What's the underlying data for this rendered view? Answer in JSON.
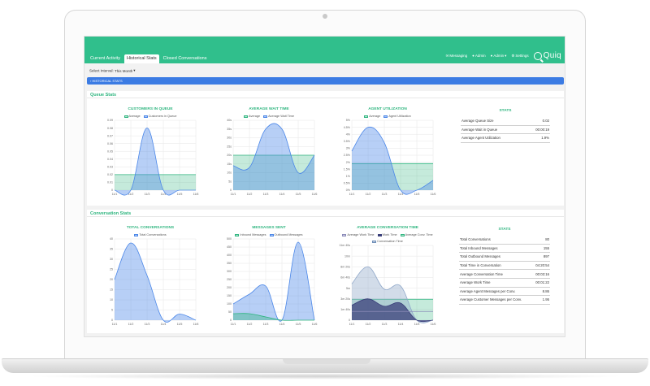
{
  "tabs": [
    {
      "label": "Current Activity",
      "active": false
    },
    {
      "label": "Historical Stats",
      "active": true
    },
    {
      "label": "Closed Conversations",
      "active": false
    }
  ],
  "nav": {
    "messaging": "Messaging",
    "admin": "Admin",
    "account": "Admin",
    "settings": "Settings",
    "logo": "Quiq"
  },
  "interval": {
    "label": "Select Interval:",
    "value": "This Month"
  },
  "historical_bar": "HISTORICAL STATS",
  "queue_section": {
    "title": "Queue Stats",
    "stats_title": "STATS",
    "stats": [
      {
        "label": "Average Queue Size",
        "value": "0.02"
      },
      {
        "label": "Average Wait in Queue",
        "value": "00:00:19"
      },
      {
        "label": "Average Agent Utilization",
        "value": "1.9%"
      }
    ]
  },
  "conversation_section": {
    "title": "Conversation Stats",
    "stats_title": "STATS",
    "stats": [
      {
        "label": "Total Conversations",
        "value": "80"
      },
      {
        "label": "Total Inbound Messages",
        "value": "155"
      },
      {
        "label": "Total Outbound Messages",
        "value": "897"
      },
      {
        "label": "Total Time in Conversation",
        "value": "04:20:54"
      },
      {
        "label": "Average Conversation Time",
        "value": "00:03:16"
      },
      {
        "label": "Average Work Time",
        "value": "00:01:22"
      },
      {
        "label": "Average Agent Messages per Conv.",
        "value": "8.86"
      },
      {
        "label": "Average Customer Messages per Conv.",
        "value": "1.95"
      }
    ]
  },
  "colors": {
    "brand": "#30bf8c",
    "accent_blue": "#3b7be3",
    "series_blue": "#4a86e8",
    "series_green": "#2fb57f"
  },
  "chart_data": [
    {
      "id": "customers-in-queue",
      "type": "area",
      "title": "CUSTOMERS IN QUEUE",
      "legend": [
        "Average",
        "Customers in Queue"
      ],
      "x": [
        "11/1",
        "11/2",
        "11/3",
        "11/4",
        "11/5",
        "11/6"
      ],
      "yticks": [
        "0",
        "0.01",
        "0.02",
        "0.03",
        "0.04",
        "0.05",
        "0.06",
        "0.07",
        "0.08",
        "0.09"
      ],
      "ylim": [
        0,
        0.09
      ],
      "series": [
        {
          "name": "Customers in Queue",
          "values": [
            0,
            0,
            0.08,
            0,
            0,
            0
          ],
          "color": "#4a86e8"
        }
      ],
      "average": 0.02
    },
    {
      "id": "average-wait-time",
      "type": "area",
      "title": "AVERAGE WAIT TIME",
      "legend": [
        "Average",
        "Average Wait Time"
      ],
      "x": [
        "11/1",
        "11/2",
        "11/3",
        "11/4",
        "11/5",
        "11/6"
      ],
      "yticks": [
        "0",
        "5s",
        "10s",
        "15s",
        "20s",
        "25s",
        "30s",
        "35s",
        "40s"
      ],
      "ylim": [
        0,
        40
      ],
      "series": [
        {
          "name": "Average Wait Time",
          "values": [
            14,
            13,
            35,
            35,
            10,
            20
          ],
          "color": "#4a86e8"
        }
      ],
      "average": 20
    },
    {
      "id": "agent-utilization",
      "type": "area",
      "title": "AGENT UTILIZATION",
      "legend": [
        "Average",
        "Agent Utilization"
      ],
      "x": [
        "11/1",
        "11/2",
        "11/3",
        "11/4",
        "11/5",
        "11/6"
      ],
      "yticks": [
        "0%",
        "0.5%",
        "1%",
        "1.5%",
        "2%",
        "2.5%",
        "3%",
        "3.5%",
        "4%",
        "4.5%",
        "5%"
      ],
      "ylim": [
        0,
        5
      ],
      "series": [
        {
          "name": "Agent Utilization",
          "values": [
            2.8,
            4.5,
            3.4,
            0,
            0,
            0.7
          ],
          "color": "#4a86e8"
        }
      ],
      "average": 1.9
    },
    {
      "id": "total-conversations",
      "type": "area",
      "title": "TOTAL CONVERSATIONS",
      "legend": [
        "Total Conversations"
      ],
      "x": [
        "11/1",
        "11/2",
        "11/3",
        "11/4",
        "11/5",
        "11/6"
      ],
      "yticks": [
        "0",
        "5",
        "10",
        "15",
        "20",
        "25",
        "30",
        "35",
        "40"
      ],
      "ylim": [
        0,
        40
      ],
      "series": [
        {
          "name": "Total Conversations",
          "values": [
            20,
            38,
            22,
            0,
            3,
            0
          ],
          "color": "#4a86e8"
        }
      ]
    },
    {
      "id": "messages-sent",
      "type": "area",
      "title": "MESSAGES SENT",
      "legend": [
        "Inbound Messages",
        "Outbound Messages"
      ],
      "x": [
        "11/1",
        "11/2",
        "11/3",
        "11/4",
        "11/5",
        "11/6"
      ],
      "yticks": [
        "0",
        "50",
        "100",
        "150",
        "200",
        "250",
        "300",
        "350",
        "400",
        "450",
        "500"
      ],
      "ylim": [
        0,
        500
      ],
      "series": [
        {
          "name": "Outbound Messages",
          "values": [
            100,
            160,
            210,
            0,
            480,
            0
          ],
          "color": "#4a86e8"
        },
        {
          "name": "Inbound Messages",
          "values": [
            40,
            40,
            20,
            0,
            0,
            0
          ],
          "color": "#2fb57f"
        }
      ]
    },
    {
      "id": "average-conversation-time",
      "type": "area",
      "title": "AVERAGE CONVERSATION TIME",
      "legend": [
        "Average Work Time",
        "Work Time",
        "Average Conv. Time",
        "Conversation Time"
      ],
      "x": [
        "11/1",
        "11/2",
        "11/3",
        "11/4",
        "11/5",
        "11/6"
      ],
      "yticks": [
        "0",
        "1m 40s",
        "3m 20s",
        "5m",
        "6m 40s",
        "8m 20s",
        "10m",
        "11m 40s"
      ],
      "ylim": [
        0,
        700
      ],
      "series": [
        {
          "name": "Conversation Time",
          "values": [
            340,
            500,
            290,
            320,
            0,
            0
          ],
          "color": "#8fa7c9"
        },
        {
          "name": "Work Time",
          "values": [
            140,
            200,
            130,
            160,
            0,
            0
          ],
          "color": "#3a3f7a"
        }
      ],
      "average": 196,
      "average_work": 82
    }
  ]
}
